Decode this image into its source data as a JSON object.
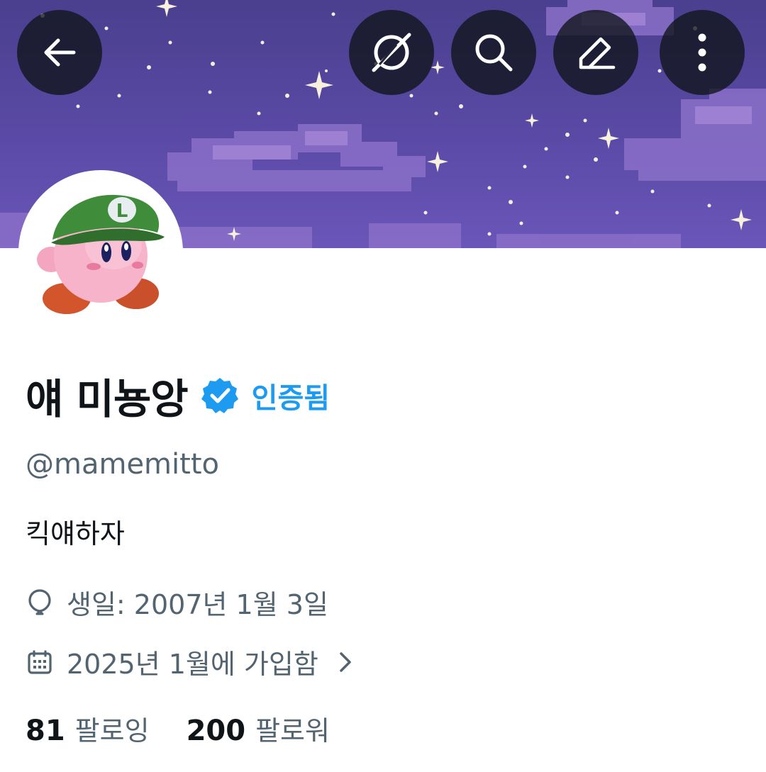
{
  "header": {
    "back_icon": "back-arrow-icon",
    "actions": [
      {
        "id": "grok",
        "icon": "grok-icon"
      },
      {
        "id": "search",
        "icon": "search-icon"
      },
      {
        "id": "edit",
        "icon": "pencil-icon"
      },
      {
        "id": "more",
        "icon": "more-vertical-icon"
      }
    ],
    "banner_colors": {
      "sky_top": "#4a3f8e",
      "sky_bottom": "#6a56b8",
      "cloud": "#8a6fc8"
    }
  },
  "profile": {
    "display_name": "얘 미뇽앙",
    "verified_label": "인증됨",
    "handle": "@mamemitto",
    "bio": "킥얘하자",
    "birthday": "생일: 2007년 1월 3일",
    "joined": "2025년 1월에 가입함",
    "following_count": "81",
    "following_label": "팔로잉",
    "followers_count": "200",
    "followers_label": "팔로워",
    "accent_color": "#1d9bf0"
  }
}
